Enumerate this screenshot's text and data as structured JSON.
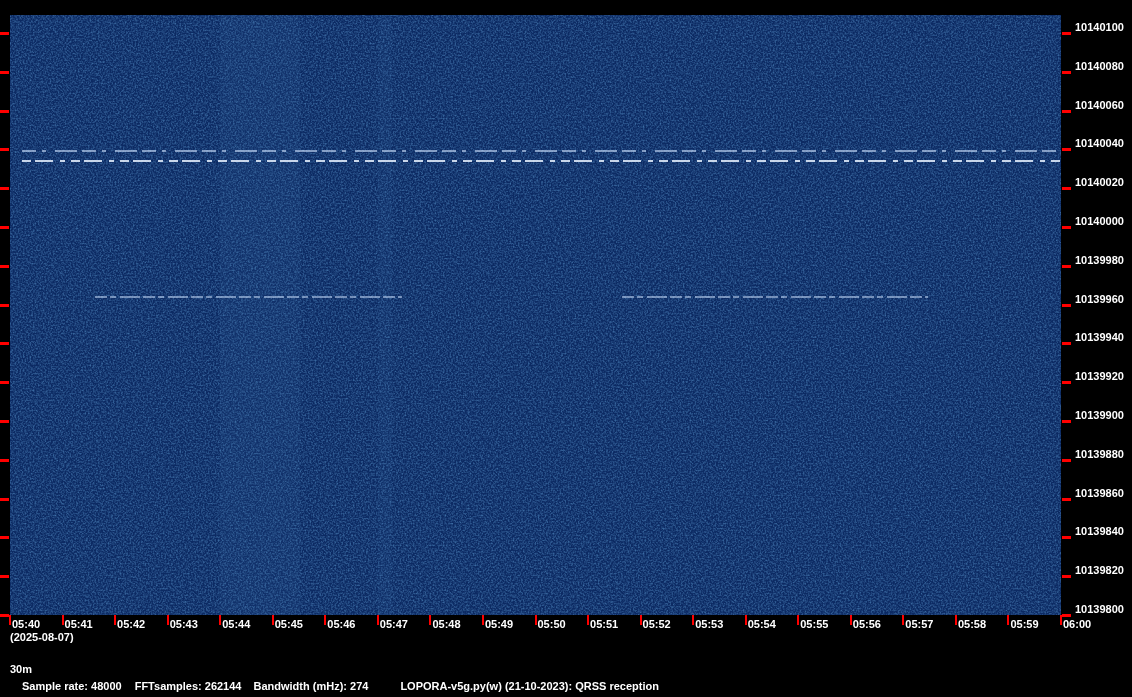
{
  "frequency_axis": {
    "labels": [
      "10140100",
      "10140080",
      "10140060",
      "10140040",
      "10140020",
      "10140000",
      "10139980",
      "10139960",
      "10139940",
      "10139920",
      "10139900",
      "10139880",
      "10139860",
      "10139840",
      "10139820",
      "10139800"
    ]
  },
  "time_axis": {
    "labels": [
      "05:40",
      "05:41",
      "05:42",
      "05:43",
      "05:44",
      "05:45",
      "05:46",
      "05:47",
      "05:48",
      "05:49",
      "05:50",
      "05:51",
      "05:52",
      "05:53",
      "05:54",
      "05:55",
      "05:56",
      "05:57",
      "05:58",
      "05:59",
      "06:00"
    ],
    "date": "(2025-08-07)"
  },
  "band": "30m",
  "info": [
    {
      "text": "Sample rate: 48000"
    },
    {
      "text": "FFTsamples: 262144"
    },
    {
      "text": "Bandwidth (mHz): 274"
    },
    {
      "text": "LOPORA-v5g.py(w) (21-10-2023): QRSS reception"
    }
  ]
}
